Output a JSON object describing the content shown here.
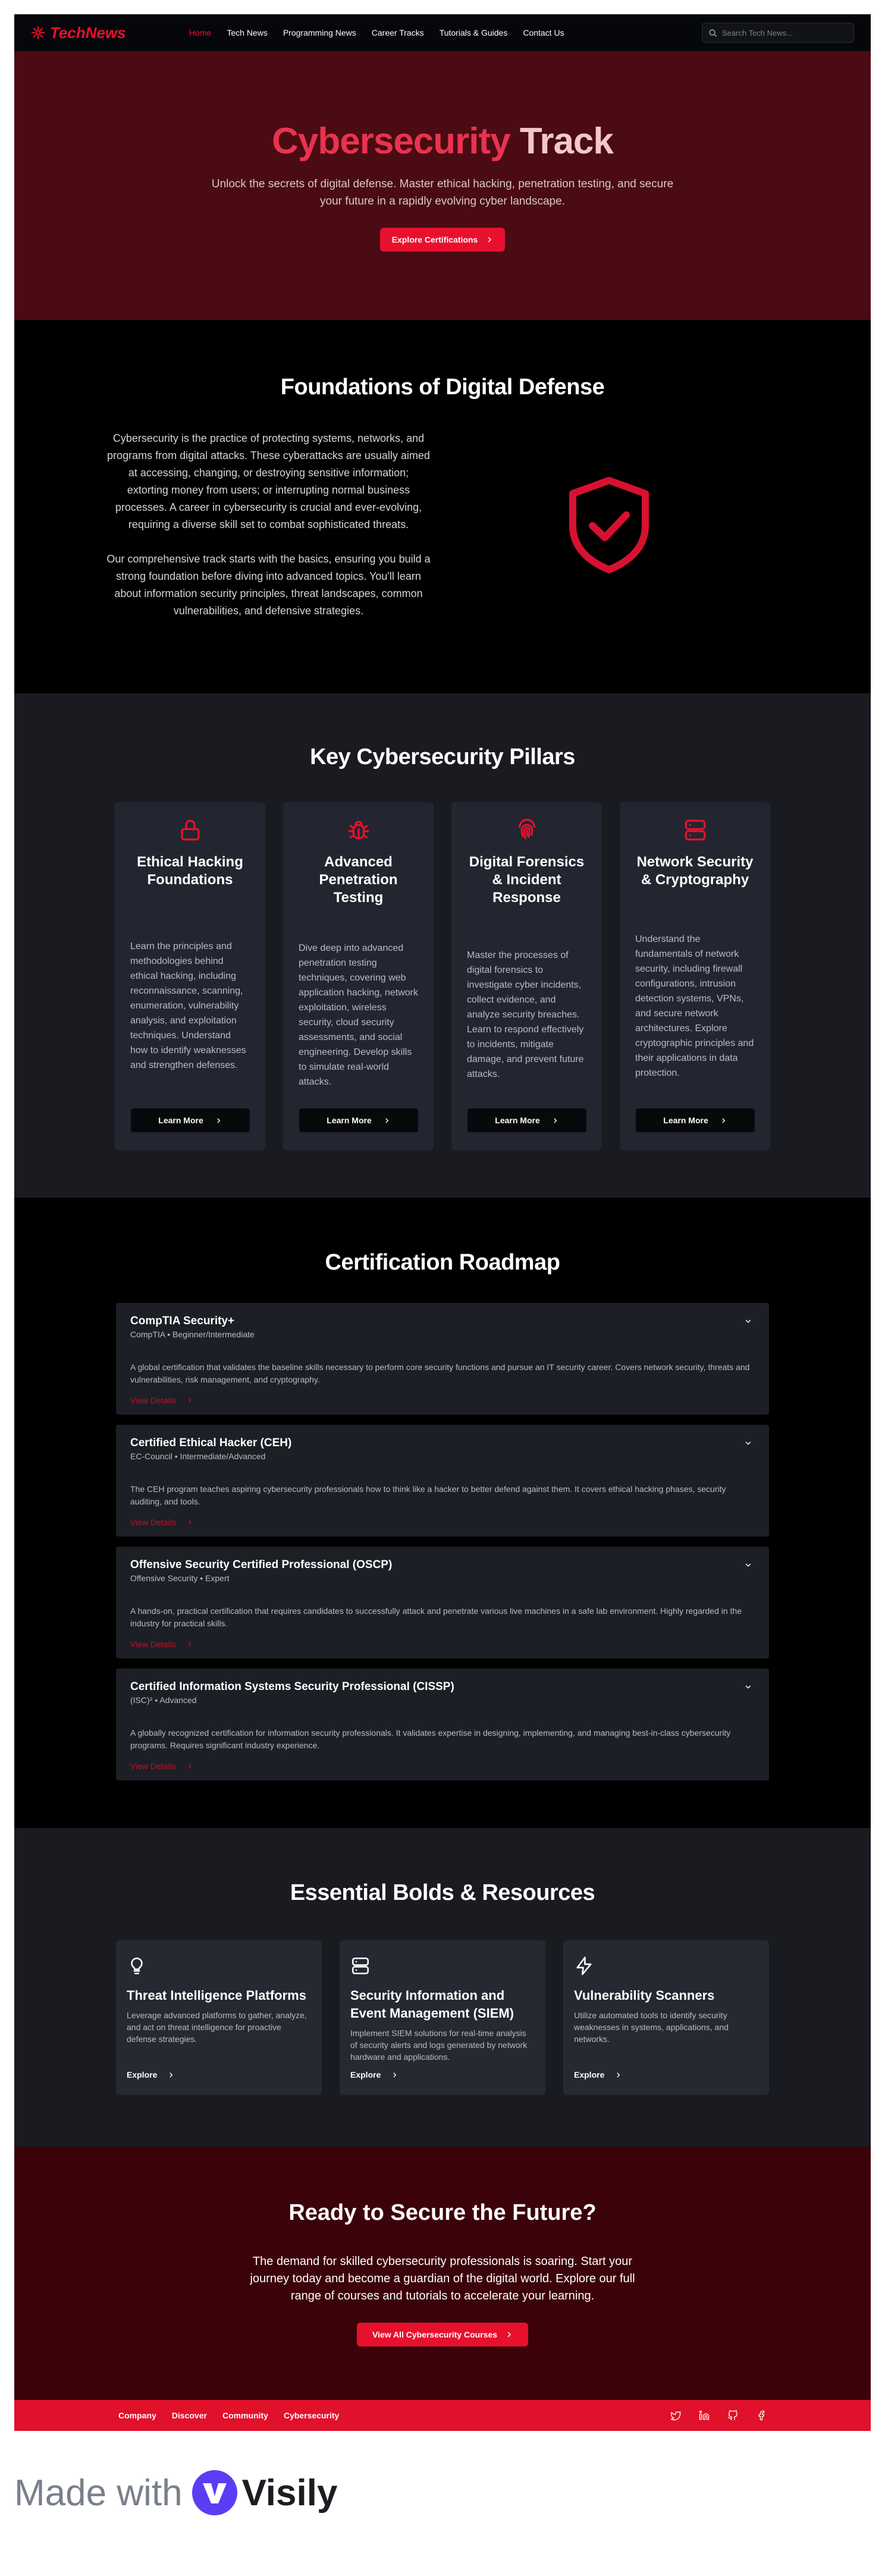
{
  "nav": {
    "logo": "TechNews",
    "links": [
      "Home",
      "Tech News",
      "Programming News",
      "Career Tracks",
      "Tutorials & Guides",
      "Contact Us"
    ],
    "search_placeholder": "Search Tech News..."
  },
  "hero": {
    "title_part1": "Cybersecurity",
    "title_part2": "Track",
    "subtitle": "Unlock the secrets of digital defense. Master ethical hacking, penetration testing, and secure your future in a rapidly evolving cyber landscape.",
    "button": "Explore Certifications"
  },
  "foundations": {
    "title": "Foundations of Digital Defense",
    "p1": "Cybersecurity is the practice of protecting systems, networks, and programs from digital attacks. These cyberattacks are usually aimed at accessing, changing, or destroying sensitive information; extorting money from users; or interrupting normal business processes. A career in cybersecurity is crucial and ever-evolving, requiring a diverse skill set to combat sophisticated threats.",
    "p2": "Our comprehensive track starts with the basics, ensuring you build a strong foundation before diving into advanced topics. You'll learn about information security principles, threat landscapes, common vulnerabilities, and defensive strategies."
  },
  "pillars": {
    "title": "Key Cybersecurity Pillars",
    "items": [
      {
        "icon": "lock-icon",
        "title": "Ethical Hacking Foundations",
        "text": "Learn the principles and methodologies behind ethical hacking, including reconnaissance, scanning, enumeration, vulnerability analysis, and exploitation techniques. Understand how to identify weaknesses and strengthen defenses.",
        "button": "Learn More"
      },
      {
        "icon": "bug-icon",
        "title": "Advanced Penetration Testing",
        "text": "Dive deep into advanced penetration testing techniques, covering web application hacking, network exploitation, wireless security, cloud security assessments, and social engineering. Develop skills to simulate real-world attacks.",
        "button": "Learn More"
      },
      {
        "icon": "fingerprint-icon",
        "title": "Digital Forensics & Incident Response",
        "text": "Master the processes of digital forensics to investigate cyber incidents, collect evidence, and analyze security breaches. Learn to respond effectively to incidents, mitigate damage, and prevent future attacks.",
        "button": "Learn More"
      },
      {
        "icon": "server-icon",
        "title": "Network Security & Cryptography",
        "text": "Understand the fundamentals of network security, including firewall configurations, intrusion detection systems, VPNs, and secure network architectures. Explore cryptographic principles and their applications in data protection.",
        "button": "Learn More"
      }
    ]
  },
  "roadmap": {
    "title": "Certification Roadmap",
    "items": [
      {
        "title": "CompTIA Security+",
        "meta": "CompTIA • Beginner/Intermediate",
        "desc": "A global certification that validates the baseline skills necessary to perform core security functions and pursue an IT security career. Covers network security, threats and vulnerabilities, risk management, and cryptography.",
        "link": "View Details"
      },
      {
        "title": "Certified Ethical Hacker (CEH)",
        "meta": "EC-Council • Intermediate/Advanced",
        "desc": "The CEH program teaches aspiring cybersecurity professionals how to think like a hacker to better defend against them. It covers ethical hacking phases, security auditing, and tools.",
        "link": "View Details"
      },
      {
        "title": "Offensive Security Certified Professional (OSCP)",
        "meta": "Offensive Security • Expert",
        "desc": "A hands-on, practical certification that requires candidates to successfully attack and penetrate various live machines in a safe lab environment. Highly regarded in the industry for practical skills.",
        "link": "View Details"
      },
      {
        "title": "Certified Information Systems Security Professional (CISSP)",
        "meta": "(ISC)² • Advanced",
        "desc": "A globally recognized certification for information security professionals. It validates expertise in designing, implementing, and managing best-in-class cybersecurity programs. Requires significant industry experience.",
        "link": "View Details"
      }
    ]
  },
  "tools": {
    "title": "Essential Bolds & Resources",
    "items": [
      {
        "icon": "lightbulb-icon",
        "title": "Threat Intelligence Platforms",
        "text": "Leverage advanced platforms to gather, analyze, and act on threat intelligence for proactive defense strategies.",
        "link": "Explore"
      },
      {
        "icon": "server-icon",
        "title": "Security Information and Event Management (SIEM)",
        "text": "Implement SIEM solutions for real-time analysis of security alerts and logs generated by network hardware and applications.",
        "link": "Explore"
      },
      {
        "icon": "zap-icon",
        "title": "Vulnerability Scanners",
        "text": "Utilize automated tools to identify security weaknesses in systems, applications, and networks.",
        "link": "Explore"
      }
    ]
  },
  "cta": {
    "title": "Ready to Secure the Future?",
    "text": "The demand for skilled cybersecurity professionals is soaring. Start your journey today and become a guardian of the digital world. Explore our full range of courses and tutorials to accelerate your learning.",
    "button": "View All Cybersecurity Courses"
  },
  "footer": {
    "links": [
      "Company",
      "Discover",
      "Community",
      "Cybersecurity"
    ],
    "socials": [
      "twitter-icon",
      "linkedin-icon",
      "github-icon",
      "facebook-icon"
    ]
  },
  "made_with": {
    "label": "Made with",
    "brand": "Visily"
  },
  "colors": {
    "accent": "#e8112d",
    "hero_bg": "#4a0b13",
    "cta_bg": "#3b0209",
    "card_bg": "#232630",
    "section_bg": "#191b21"
  }
}
